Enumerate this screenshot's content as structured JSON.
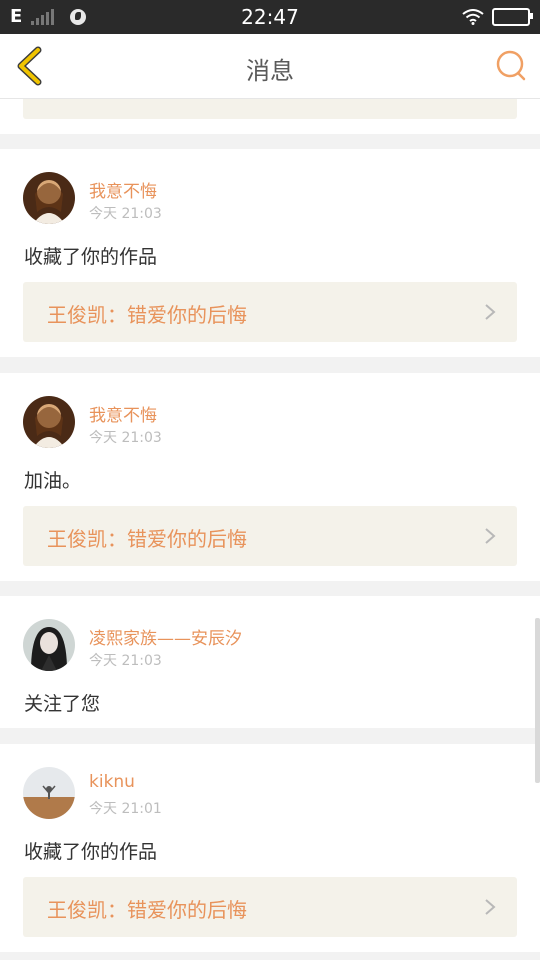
{
  "status_bar": {
    "carrier": "E",
    "time": "22:47"
  },
  "header": {
    "title": "消息"
  },
  "messages": [
    {
      "username": "我意不悔",
      "time": "今天 21:03",
      "text": "收藏了你的作品",
      "work": "王俊凯：错爱你的后悔"
    },
    {
      "username": "我意不悔",
      "time": "今天 21:03",
      "text": "加油。",
      "work": "王俊凯：错爱你的后悔"
    },
    {
      "username": "凌熙家族——安辰汐",
      "time": "今天 21:03",
      "text": "关注了您"
    },
    {
      "username": "kiknu",
      "time": "今天 21:01",
      "text": "收藏了你的作品",
      "work": "王俊凯：错爱你的后悔"
    }
  ],
  "colors": {
    "accent": "#e8935b",
    "back_arrow": "#f0b400",
    "work_bg": "#f4f2ea"
  }
}
